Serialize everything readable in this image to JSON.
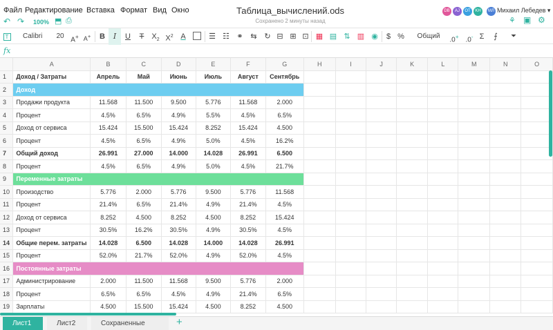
{
  "menu": {
    "items": [
      "Файл",
      "Редактирование",
      "Вставка",
      "Формат",
      "Вид",
      "Окно"
    ]
  },
  "document": {
    "title": "Таблица_вычислений.ods",
    "save_status": "Сохранено 2 минуты назад"
  },
  "collaborators": [
    {
      "initials": "DB",
      "color": "#e1579a"
    },
    {
      "initials": "AJ",
      "color": "#8a63d2"
    },
    {
      "initials": "OT",
      "color": "#3aa0e0"
    },
    {
      "initials": "KH",
      "color": "#2fb3a0"
    },
    {
      "initials": "МЛ",
      "color": "#4a7fd6"
    }
  ],
  "user": {
    "name": "Михаил Лебедев ▾"
  },
  "quick": {
    "zoom": "100%"
  },
  "toolbar": {
    "font_name": "Calibri",
    "font_size": "20",
    "number_format": "Общий"
  },
  "formula": {
    "label": "fx",
    "value": ""
  },
  "columns": [
    "A",
    "B",
    "C",
    "D",
    "E",
    "F",
    "G",
    "H",
    "I",
    "J",
    "K",
    "L",
    "M",
    "N",
    "O"
  ],
  "rows": [
    {
      "n": "1",
      "a": "Доход / Затраты",
      "vals": [
        "Апрель",
        "Май",
        "Июнь",
        "Июль",
        "Август",
        "Сентябрь"
      ],
      "type": "header"
    },
    {
      "n": "2",
      "a": "Доход",
      "vals": [],
      "type": "section",
      "color": "#6dcdf0"
    },
    {
      "n": "3",
      "a": "Продажи продукта",
      "vals": [
        "11.568",
        "11.500",
        "9.500",
        "5.776",
        "11.568",
        "2.000"
      ],
      "type": "normal"
    },
    {
      "n": "4",
      "a": "Процент",
      "vals": [
        "4.5%",
        "6.5%",
        "4.9%",
        "5.5%",
        "4.5%",
        "6.5%"
      ],
      "type": "normal"
    },
    {
      "n": "5",
      "a": "Доход от сервиса",
      "vals": [
        "15.424",
        "15.500",
        "15.424",
        "8.252",
        "15.424",
        "4.500"
      ],
      "type": "normal"
    },
    {
      "n": "6",
      "a": "Процент",
      "vals": [
        "4.5%",
        "6.5%",
        "4.9%",
        "5.0%",
        "4.5%",
        "16.2%"
      ],
      "type": "normal"
    },
    {
      "n": "7",
      "a": "Общий доход",
      "vals": [
        "26.991",
        "27.000",
        "14.000",
        "14.028",
        "26.991",
        "6.500"
      ],
      "type": "bold"
    },
    {
      "n": "8",
      "a": "Процент",
      "vals": [
        "4.5%",
        "6.5%",
        "4.9%",
        "5.0%",
        "4.5%",
        "21.7%"
      ],
      "type": "normal"
    },
    {
      "n": "9",
      "a": "Переменные затраты",
      "vals": [],
      "type": "section",
      "color": "#6ddf9a"
    },
    {
      "n": "10",
      "a": "Произодство",
      "vals": [
        "5.776",
        "2.000",
        "5.776",
        "9.500",
        "5.776",
        "11.568"
      ],
      "type": "normal"
    },
    {
      "n": "11",
      "a": "Процент",
      "vals": [
        "21.4%",
        "6.5%",
        "21.4%",
        "4.9%",
        "21.4%",
        "4.5%"
      ],
      "type": "normal"
    },
    {
      "n": "12",
      "a": "Доход от сервиса",
      "vals": [
        "8.252",
        "4.500",
        "8.252",
        "4.500",
        "8.252",
        "15.424"
      ],
      "type": "normal"
    },
    {
      "n": "13",
      "a": "Процент",
      "vals": [
        "30.5%",
        "16.2%",
        "30.5%",
        "4.9%",
        "30.5%",
        "4.5%"
      ],
      "type": "normal"
    },
    {
      "n": "14",
      "a": "Общие перем. затраты",
      "vals": [
        "14.028",
        "6.500",
        "14.028",
        "14.000",
        "14.028",
        "26.991"
      ],
      "type": "bold"
    },
    {
      "n": "15",
      "a": "Процент",
      "vals": [
        "52.0%",
        "21.7%",
        "52.0%",
        "4.9%",
        "52.0%",
        "4.5%"
      ],
      "type": "normal"
    },
    {
      "n": "16",
      "a": "Постоянные затраты",
      "vals": [],
      "type": "section",
      "color": "#e68cc6"
    },
    {
      "n": "17",
      "a": "Администрирование",
      "vals": [
        "2.000",
        "11.500",
        "11.568",
        "9.500",
        "5.776",
        "2.000"
      ],
      "type": "normal"
    },
    {
      "n": "18",
      "a": "Процент",
      "vals": [
        "6.5%",
        "6.5%",
        "4.5%",
        "4.9%",
        "21.4%",
        "6.5%"
      ],
      "type": "normal"
    },
    {
      "n": "19",
      "a": "Зарплаты",
      "vals": [
        "4.500",
        "15.500",
        "15.424",
        "4.500",
        "8.252",
        "4.500"
      ],
      "type": "normal"
    }
  ],
  "sheets": [
    {
      "label": "Лист1",
      "active": true
    },
    {
      "label": "Лист2",
      "active": false
    },
    {
      "label": "Сохраненные дан...",
      "active": false
    }
  ]
}
